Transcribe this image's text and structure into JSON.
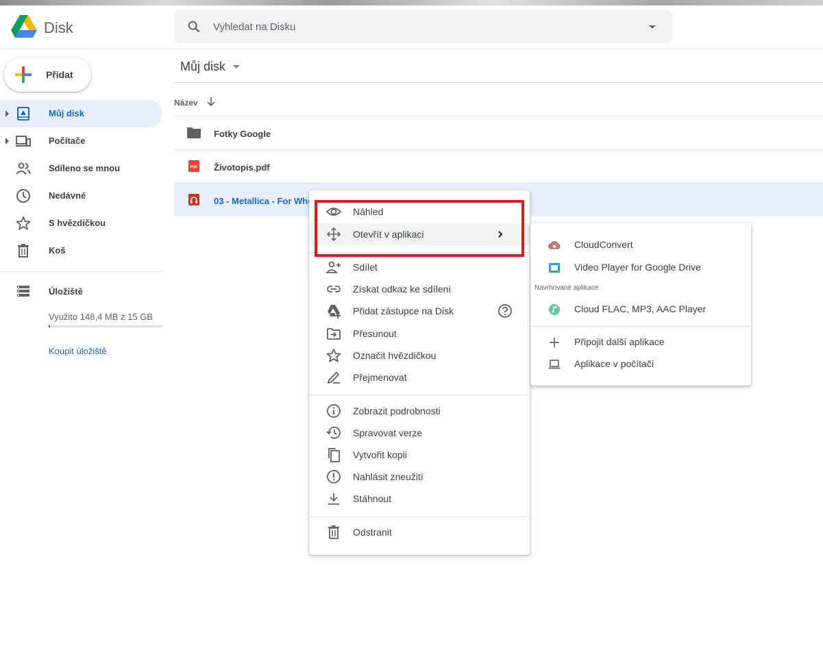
{
  "app": {
    "brand": "Disk"
  },
  "search": {
    "placeholder": "Vyhledat na Disku"
  },
  "new_button": {
    "label": "Přidat"
  },
  "sidebar": {
    "items": [
      {
        "label": "Můj disk",
        "icon": "my-drive-icon",
        "active": true
      },
      {
        "label": "Počítače",
        "icon": "computers-icon"
      },
      {
        "label": "Sdíleno se mnou",
        "icon": "shared-icon"
      },
      {
        "label": "Nedávné",
        "icon": "clock-icon"
      },
      {
        "label": "S hvězdičkou",
        "icon": "star-icon"
      },
      {
        "label": "Koš",
        "icon": "trash-icon"
      }
    ],
    "storage": {
      "label": "Úložiště",
      "used": "Využito 148,4 MB z 15 GB",
      "used_fraction": 0.01,
      "buy": "Koupit úložiště"
    }
  },
  "main": {
    "title": "Můj disk",
    "column_name": "Název",
    "files": [
      {
        "name": "Fotky Google",
        "icon": "folder-icon"
      },
      {
        "name": "Životopis.pdf",
        "icon": "pdf-icon"
      },
      {
        "name": "03 - Metallica - For Who",
        "icon": "audio-file-icon",
        "selected": true
      }
    ]
  },
  "context_menu": {
    "items": [
      {
        "label": "Náhled",
        "icon": "eye-icon"
      },
      {
        "label": "Otevřít v aplikaci",
        "icon": "open-with-icon"
      },
      {
        "label": "Sdílet",
        "icon": "person-add-icon"
      },
      {
        "label": "Získat odkaz ke sdílení",
        "icon": "link-icon"
      },
      {
        "label": "Přidat zástupce na Disk",
        "icon": "drive-shortcut-icon"
      },
      {
        "label": "Přesunout",
        "icon": "move-icon"
      },
      {
        "label": "Označit hvězdičkou",
        "icon": "star-icon"
      },
      {
        "label": "Přejmenovat",
        "icon": "pencil-icon"
      },
      {
        "label": "Zobrazit podrobnosti",
        "icon": "info-icon"
      },
      {
        "label": "Spravovat verze",
        "icon": "history-icon"
      },
      {
        "label": "Vytvořit kopii",
        "icon": "copy-icon"
      },
      {
        "label": "Nahlásit zneužití",
        "icon": "report-icon"
      },
      {
        "label": "Stáhnout",
        "icon": "download-icon"
      },
      {
        "label": "Odstranit",
        "icon": "trash-icon"
      }
    ]
  },
  "submenu": {
    "items": [
      {
        "label": "CloudConvert",
        "icon": "cloudconvert-icon"
      },
      {
        "label": "Video Player for Google Drive",
        "icon": "video-player-icon"
      },
      {
        "label": "Cloud FLAC, MP3, AAC Player",
        "icon": "music-player-icon"
      },
      {
        "label": "Připojit další aplikace",
        "icon": "plus-icon"
      },
      {
        "label": "Aplikace v počítači",
        "icon": "laptop-icon"
      }
    ],
    "heading": "Navrhované aplikace"
  },
  "colors": {
    "accent": "#1967d2",
    "active_bg": "#e8f0fe",
    "highlight_box": "#e3191c",
    "pdf_red": "#ea4335"
  }
}
